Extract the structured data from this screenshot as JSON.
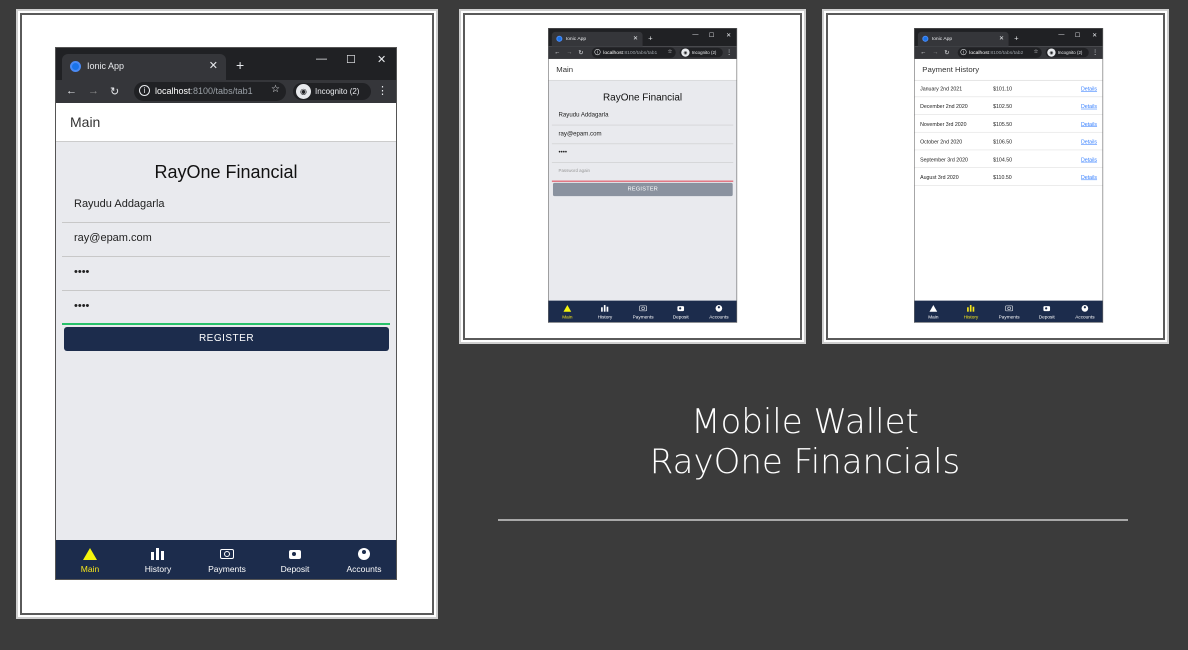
{
  "colors": {
    "nav_bg": "#1c2c4c",
    "nav_active": "#f5e51b",
    "register_active": "#1c2c4c",
    "register_disabled": "#8a929f",
    "link": "#3880ff"
  },
  "browser": {
    "tab_title": "Ionic App",
    "host": "localhost",
    "incognito": "Incognito (2)"
  },
  "screens": [
    {
      "url_path": ":8100/tabs/tab1",
      "app_title": "Main",
      "form": {
        "title": "RayOne Financial",
        "name": "Rayudu Addagarla",
        "email": "ray@epam.com",
        "password": "••••",
        "password_again": "••••",
        "register": "REGISTER"
      }
    },
    {
      "url_path": ":8100/tabs/tab1",
      "app_title": "Main",
      "form": {
        "title": "RayOne Financial",
        "name": "Rayudu Addagarla",
        "email": "ray@epam.com",
        "password": "••••",
        "password_again_placeholder": "Password again",
        "register": "REGISTER"
      }
    },
    {
      "url_path": ":8100/tabs/tab2",
      "app_title": "Payment History",
      "payments": [
        {
          "date": "January 2nd 2021",
          "amount": "$101.10",
          "link": "Details"
        },
        {
          "date": "December 2nd 2020",
          "amount": "$102.50",
          "link": "Details"
        },
        {
          "date": "November 3rd 2020",
          "amount": "$105.50",
          "link": "Details"
        },
        {
          "date": "October 2nd 2020",
          "amount": "$106.50",
          "link": "Details"
        },
        {
          "date": "September 3rd 2020",
          "amount": "$104.50",
          "link": "Details"
        },
        {
          "date": "August 3rd 2020",
          "amount": "$110.50",
          "link": "Details"
        }
      ]
    }
  ],
  "tabs": [
    {
      "label": "Main",
      "icon": "warning-triangle-icon"
    },
    {
      "label": "History",
      "icon": "bar-chart-icon"
    },
    {
      "label": "Payments",
      "icon": "cash-icon"
    },
    {
      "label": "Deposit",
      "icon": "camera-icon"
    },
    {
      "label": "Accounts",
      "icon": "account-icon"
    }
  ],
  "caption": {
    "line1": "Mobile Wallet",
    "line2": "RayOne Financials"
  }
}
